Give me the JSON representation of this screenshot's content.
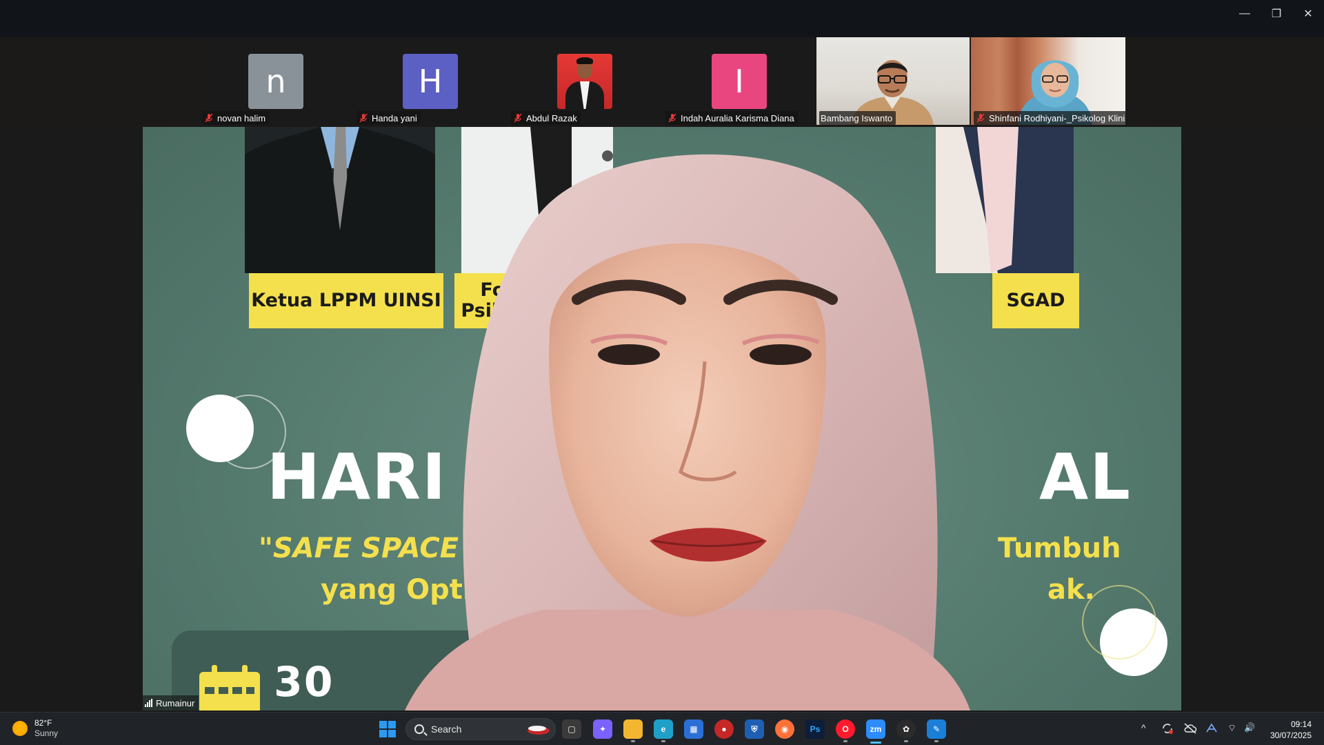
{
  "window": {
    "controls": {
      "minimize": "—",
      "maximize": "❐",
      "close": "✕"
    }
  },
  "participants": [
    {
      "name": "novan halim",
      "initial": "n",
      "color": "#8a9299",
      "muted": true
    },
    {
      "name": "Handa yani",
      "initial": "H",
      "color": "#5c5fc4",
      "muted": true
    },
    {
      "name": "Abdul Razak",
      "initial": "",
      "color": "#e53935",
      "muted": true
    },
    {
      "name": "Indah Auralia Karisma Diana",
      "initial": "I",
      "color": "#e9467f",
      "muted": true
    },
    {
      "name": "Bambang Iswanto",
      "muted": false
    },
    {
      "name": "Shinfani Rodhiyani-_Psikolog Klinis",
      "muted": true
    }
  ],
  "main": {
    "speaker": "Rumainur",
    "poster": {
      "label_left": "Ketua LPPM UINSI",
      "label_mid_1": "Founder",
      "label_mid_2": "Psikologi \"K",
      "label_right": "SGAD",
      "title_left": "HARI A",
      "title_right": "AL",
      "sub_left_1": "\"SAFE SPACE DI",
      "sub_right_1": "Tumbuh",
      "sub_left_2": "yang Optim",
      "sub_right_2": "ak.",
      "date_partial": "30"
    }
  },
  "taskbar": {
    "weather_temp": "82°F",
    "weather_desc": "Sunny",
    "search_placeholder": "Search",
    "clock_time": "09:14",
    "clock_date": "30/07/2025",
    "apps": [
      {
        "name": "task-view",
        "glyph": "▢",
        "color": "#3a3a3a"
      },
      {
        "name": "copilot",
        "glyph": "✦",
        "color": "#7b61ff"
      },
      {
        "name": "file-explorer",
        "glyph": "",
        "color": "#f2b630"
      },
      {
        "name": "edge",
        "glyph": "e",
        "color": "#1fa0c7"
      },
      {
        "name": "store",
        "glyph": "▦",
        "color": "#2a6fd6"
      },
      {
        "name": "app-red",
        "glyph": "●",
        "color": "#c62828"
      },
      {
        "name": "bitwarden",
        "glyph": "⛨",
        "color": "#1e5fb3"
      },
      {
        "name": "firefox",
        "glyph": "◉",
        "color": "#ff7139"
      },
      {
        "name": "photoshop",
        "glyph": "Ps",
        "color": "#0d1e3a"
      },
      {
        "name": "opera",
        "glyph": "O",
        "color": "#ff1b2d"
      },
      {
        "name": "zoom",
        "glyph": "zm",
        "color": "#2d8cff"
      },
      {
        "name": "chatgpt",
        "glyph": "✿",
        "color": "#2b2b2b"
      },
      {
        "name": "app-blue",
        "glyph": "✎",
        "color": "#1b7fd8"
      }
    ],
    "tray": {
      "chevron": "^",
      "wifi": "⌔",
      "volume": "🔊"
    }
  }
}
